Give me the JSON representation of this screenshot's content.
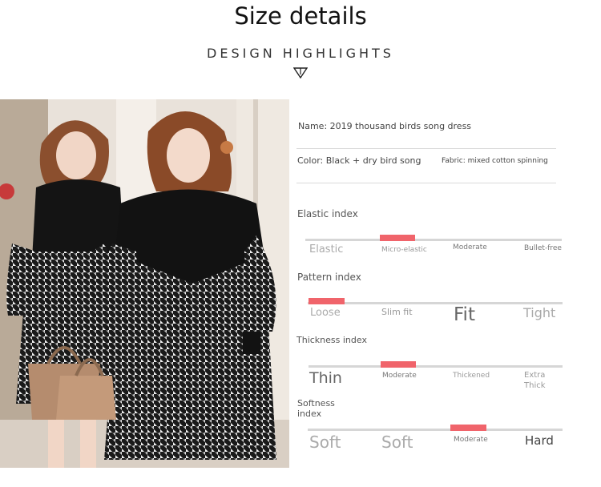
{
  "header": {
    "title": "Size details",
    "subtitle": "DESIGN HIGHLIGHTS"
  },
  "product": {
    "name": "Name: 2019 thousand birds song dress",
    "color": "Color: Black + dry bird song",
    "fabric": "Fabric: mixed cotton spinning"
  },
  "indexes": {
    "elastic": {
      "label": "Elastic index",
      "options": [
        "Elastic",
        "Micro-elastic",
        "Moderate",
        "Bullet-free"
      ],
      "selected": "Micro-elastic"
    },
    "pattern": {
      "label": "Pattern index",
      "options": [
        "Loose",
        "Slim fit",
        "Fit",
        "Tight"
      ],
      "selected": "Loose"
    },
    "thickness": {
      "label": "Thickness index",
      "options": [
        "Thin",
        "Moderate",
        "Thickened",
        "Extra Thick"
      ],
      "selected": "Moderate"
    },
    "softness": {
      "label": "Softness index",
      "options": [
        "Soft",
        "Soft",
        "Moderate",
        "Hard"
      ],
      "selected": "Moderate"
    }
  },
  "colors": {
    "marker": "#f0646b",
    "track": "#d6d6d6"
  }
}
